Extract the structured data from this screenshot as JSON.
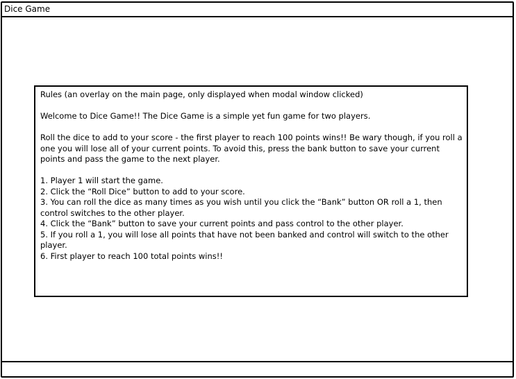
{
  "window": {
    "title": "Dice Game"
  },
  "modal": {
    "heading": "Rules (an overlay on the main page, only displayed when modal window clicked)",
    "welcome": "Welcome to Dice Game!! The Dice Game is a simple yet fun game for two players.",
    "intro": "Roll the dice to add to your score - the first player to reach 100 points wins!! Be wary though, if you roll a one you will lose all of your current points. To avoid this, press the bank button to save your current points and pass the game to the next player.",
    "steps": [
      "1. Player 1 will start the game.",
      "2. Click the “Roll Dice” button to add to your score.",
      "3. You can roll the dice as many times as you wish until you click the “Bank” button OR roll a 1, then control switches to the other player.",
      "4. Click the “Bank” button to save your current points and pass control to the other player.",
      "5. If you roll a 1, you will lose all points that have not been banked and control will switch to the other player.",
      "6. First player to reach 100 total points wins!!"
    ]
  }
}
